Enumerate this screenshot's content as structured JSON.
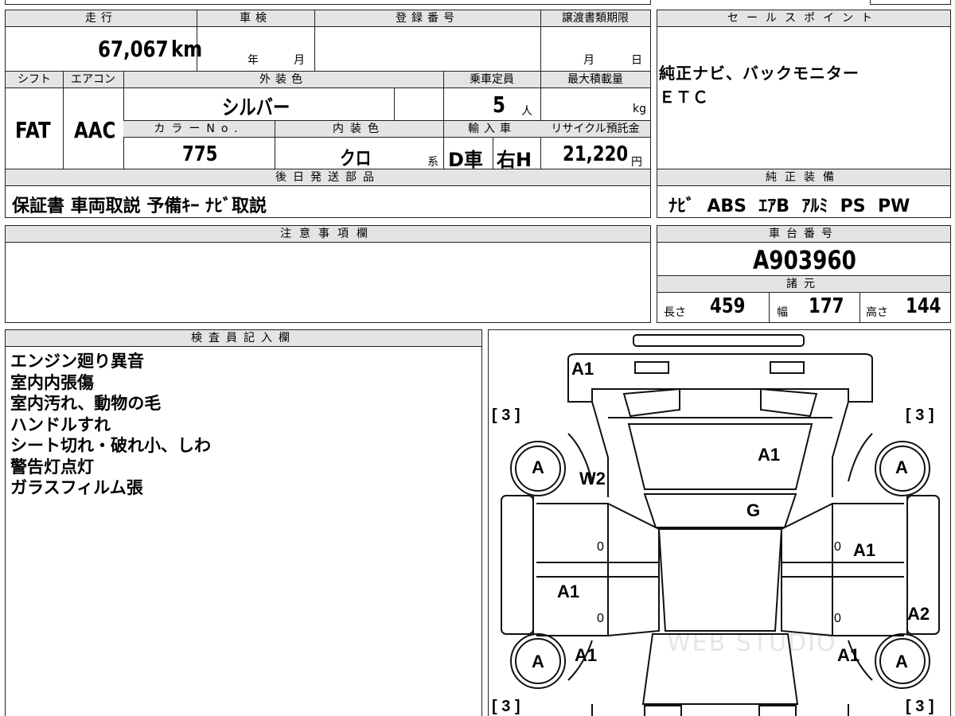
{
  "vehicle": {
    "mileage_label": "走行",
    "mileage_value": "67,067",
    "mileage_unit": "km",
    "shaken_label": "車検",
    "shaken_year_unit": "年",
    "shaken_month_unit": "月",
    "reg_label": "登録番号",
    "transfer_label": "譲渡書類期限",
    "transfer_month_unit": "月",
    "transfer_day_unit": "日",
    "shift_label": "シフト",
    "shift_value": "FAT",
    "ac_label": "エアコン",
    "ac_value": "AAC",
    "exterior_label": "外装色",
    "exterior_value": "シルバー",
    "capacity_label": "乗車定員",
    "capacity_value": "5",
    "capacity_unit": "人",
    "load_label": "最大積載量",
    "load_unit": "kg",
    "color_no_label": "カラーNo.",
    "color_no_value": "775",
    "interior_label": "内装色",
    "interior_value": "クロ",
    "interior_unit": "系",
    "import_label": "輸入車",
    "import_value": "D車",
    "handle_value": "右H",
    "recycle_label": "リサイクル預託金",
    "recycle_value": "21,220",
    "recycle_unit": "円"
  },
  "later_parts": {
    "label": "後日発送部品",
    "value": "保証書 車両取説 予備ｷｰ ﾅﾋﾞ取説"
  },
  "notes_section": {
    "label": "注意事項欄"
  },
  "sales_points": {
    "label": "セールスポイント",
    "lines": [
      "純正ナビ、バックモニター",
      "ＥＴＣ"
    ]
  },
  "equipment": {
    "label": "純正装備",
    "value": "ﾅﾋﾞ  ABS  ｴｱB  ｱﾙﾐ  PS  PW"
  },
  "chassis": {
    "label": "車台番号",
    "value": "A903960"
  },
  "specs": {
    "label": "諸元",
    "length_label": "長さ",
    "length_value": "459",
    "width_label": "幅",
    "width_value": "177",
    "height_label": "高さ",
    "height_value": "144"
  },
  "inspector": {
    "label": "検査員記入欄",
    "lines": [
      "エンジン廻り異音",
      "室内内張傷",
      "室内汚れ、動物の毛",
      "ハンドルすれ",
      "シート切れ・破れ小、しわ",
      "警告灯点灯",
      "ガラスフィルム張"
    ]
  },
  "diagram": {
    "marks": {
      "front_bumper": "A1",
      "windshield": "A1",
      "front_left_fender": "W2",
      "roof": "G",
      "right_front_door": "A1",
      "left_rear_door": "A1",
      "right_rear_quarter": "A2",
      "left_rear_fender": "A1",
      "right_rear_fender": "A1",
      "wheel_fl": "A",
      "wheel_fr": "A",
      "wheel_rl": "A",
      "wheel_rr": "A",
      "tire_fl": "[ 3 ]",
      "tire_fr": "[ 3 ]",
      "tire_rl": "[ 3 ]",
      "tire_rr": "[ 3 ]",
      "door_count_1": "0",
      "door_count_2": "0",
      "door_count_3": "0",
      "door_count_4": "0"
    },
    "watermark": "WEB STUDIO"
  }
}
